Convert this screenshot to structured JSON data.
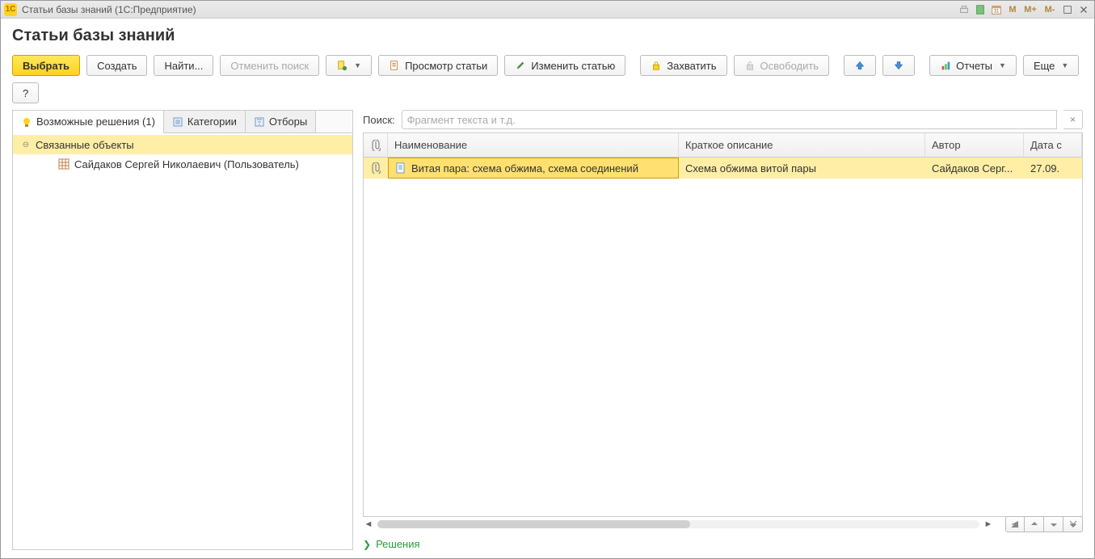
{
  "window": {
    "title": "Статьи базы знаний  (1С:Предприятие)"
  },
  "page": {
    "title": "Статьи базы знаний"
  },
  "toolbar": {
    "select": "Выбрать",
    "create": "Создать",
    "find": "Найти...",
    "cancel_search": "Отменить поиск",
    "view_article": "Просмотр статьи",
    "edit_article": "Изменить статью",
    "capture": "Захватить",
    "release": "Освободить",
    "reports": "Отчеты",
    "more": "Еще",
    "help": "?"
  },
  "tabs": {
    "solutions": "Возможные решения (1)",
    "categories": "Категории",
    "filters": "Отборы"
  },
  "tree": {
    "group_label": "Связанные объекты",
    "child_label": "Сайдаков Сергей Николаевич (Пользователь)"
  },
  "search": {
    "label": "Поиск:",
    "placeholder": "Фрагмент текста и т.д."
  },
  "table": {
    "headers": {
      "name": "Наименование",
      "desc": "Краткое описание",
      "author": "Автор",
      "date": "Дата с"
    },
    "rows": [
      {
        "name": "Витая пара: схема обжима, схема соединений",
        "desc": "Схема обжима витой пары",
        "author": "Сайдаков Серг...",
        "date": "27.09."
      }
    ]
  },
  "footer": {
    "solutions": "Решения"
  }
}
